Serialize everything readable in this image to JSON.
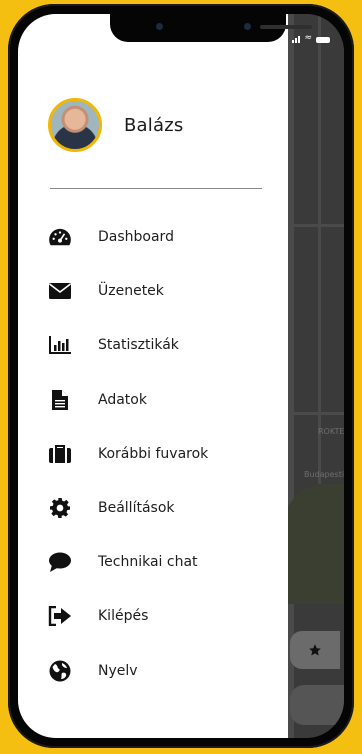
{
  "accent": "#f4bf11",
  "user": {
    "name": "Balázs"
  },
  "menu": [
    {
      "label": "Dashboard",
      "icon": "dashboard-gauge-icon"
    },
    {
      "label": "Üzenetek",
      "icon": "envelope-icon"
    },
    {
      "label": "Statisztikák",
      "icon": "bar-chart-icon"
    },
    {
      "label": "Adatok",
      "icon": "document-icon"
    },
    {
      "label": "Korábbi fuvarok",
      "icon": "suitcase-icon"
    },
    {
      "label": "Beállítások",
      "icon": "gear-icon"
    },
    {
      "label": "Technikai chat",
      "icon": "chat-bubble-icon"
    },
    {
      "label": "Kilépés",
      "icon": "sign-out-icon"
    },
    {
      "label": "Nyelv",
      "icon": "globe-icon"
    }
  ],
  "map": {
    "labels": [
      "ROKTE",
      "Budapesti T"
    ]
  }
}
